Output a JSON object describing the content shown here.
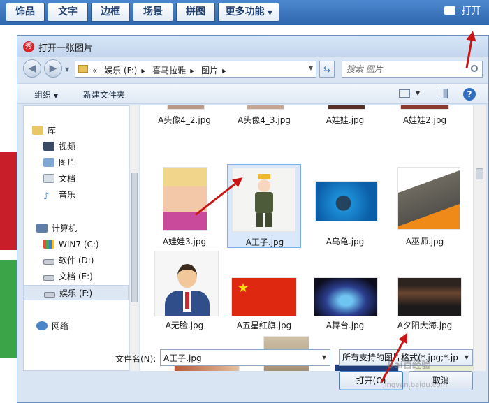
{
  "app_toolbar": {
    "tabs": [
      "饰品",
      "文字",
      "边框",
      "场景",
      "拼图",
      "更多功能"
    ],
    "more_dropdown_icon": "chevron-down-icon",
    "open_label": "打开",
    "open_icon": "folder-icon"
  },
  "dialog": {
    "title": "打开一张图片",
    "breadcrumb": [
      "«",
      "娱乐 (F:)",
      "喜马拉雅",
      "图片"
    ],
    "search_placeholder": "搜索 图片",
    "commands": {
      "organize": "组织",
      "new_folder": "新建文件夹"
    },
    "nav": [
      {
        "label": "库",
        "icon": "library-icon"
      },
      {
        "label": "视频",
        "icon": "video-icon"
      },
      {
        "label": "图片",
        "icon": "pictures-icon"
      },
      {
        "label": "文档",
        "icon": "documents-icon"
      },
      {
        "label": "音乐",
        "icon": "music-icon"
      },
      {
        "label": "计算机",
        "icon": "computer-icon"
      },
      {
        "label": "WIN7 (C:)",
        "icon": "drive-icon"
      },
      {
        "label": "软件 (D:)",
        "icon": "drive-icon"
      },
      {
        "label": "文档 (E:)",
        "icon": "drive-icon"
      },
      {
        "label": "娱乐 (F:)",
        "icon": "drive-icon",
        "selected": true
      },
      {
        "label": "网络",
        "icon": "network-icon"
      }
    ],
    "files": [
      {
        "name": "A头像4_2.jpg"
      },
      {
        "name": "A头像4_3.jpg"
      },
      {
        "name": "A娃娃.jpg"
      },
      {
        "name": "A娃娃2.jpg"
      },
      {
        "name": "A娃娃3.jpg"
      },
      {
        "name": "A王子.jpg",
        "selected": true
      },
      {
        "name": "A乌龟.jpg"
      },
      {
        "name": "A巫师.jpg"
      },
      {
        "name": "A无脸.jpg"
      },
      {
        "name": "A五星红旗.jpg"
      },
      {
        "name": "A舞台.jpg"
      },
      {
        "name": "A夕阳大海.jpg"
      }
    ],
    "filename_label": "文件名(N):",
    "filename_value": "A王子.jpg",
    "filetype_value": "所有支持的图片格式(*.jpg;*.jp",
    "open_button": "打开(O)",
    "cancel_button": "取消"
  },
  "watermark": {
    "text": "Bai百经验",
    "subtext": "jingyan.baidu.com"
  },
  "colors": {
    "toolbar": "#2f66ad",
    "dialog_bg": "#d9e5f3",
    "selection": "#d9e9fb",
    "arrow": "#c71414"
  }
}
